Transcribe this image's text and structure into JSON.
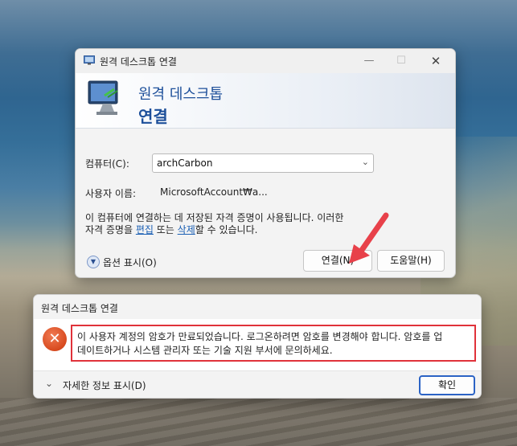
{
  "rdp": {
    "title": "원격 데스크톱 연결",
    "window_controls": {
      "minimize": "—",
      "maximize": "☐",
      "close": "✕"
    },
    "banner": {
      "line1": "원격 데스크톱",
      "line2": "연결"
    },
    "computer_label": "컴퓨터(C):",
    "computer_value": "archCarbon",
    "user_label": "사용자 이름:",
    "user_value": "MicrosoftAccount₩a...",
    "info_line1": "이 컴퓨터에 연결하는 데 저장된 자격 증명이 사용됩니다. 이러한",
    "info_prefix": "자격 증명을 ",
    "edit_link": "편집",
    "info_middle": " 또는 ",
    "delete_link": "삭제",
    "info_suffix": "할 수 있습니다.",
    "options_label": "옵션 표시(O)",
    "connect_button": "연결(N)",
    "help_button": "도움말(H)"
  },
  "error": {
    "title": "원격 데스크톱 연결",
    "icon_glyph": "✕",
    "message_line1": "이 사용자 계정의 암호가 만료되었습니다. 로그온하려면 암호를 변경해야 합니다. 암호를 업",
    "message_line2": "데이트하거나 시스템 관리자 또는 기술 지원 부서에 문의하세요.",
    "details_label": "자세한 정보 표시(D)",
    "ok_button": "확인"
  },
  "colors": {
    "accent": "#1d4f9a",
    "highlight_red": "#e0323a",
    "error_icon": "#d84a1f"
  }
}
